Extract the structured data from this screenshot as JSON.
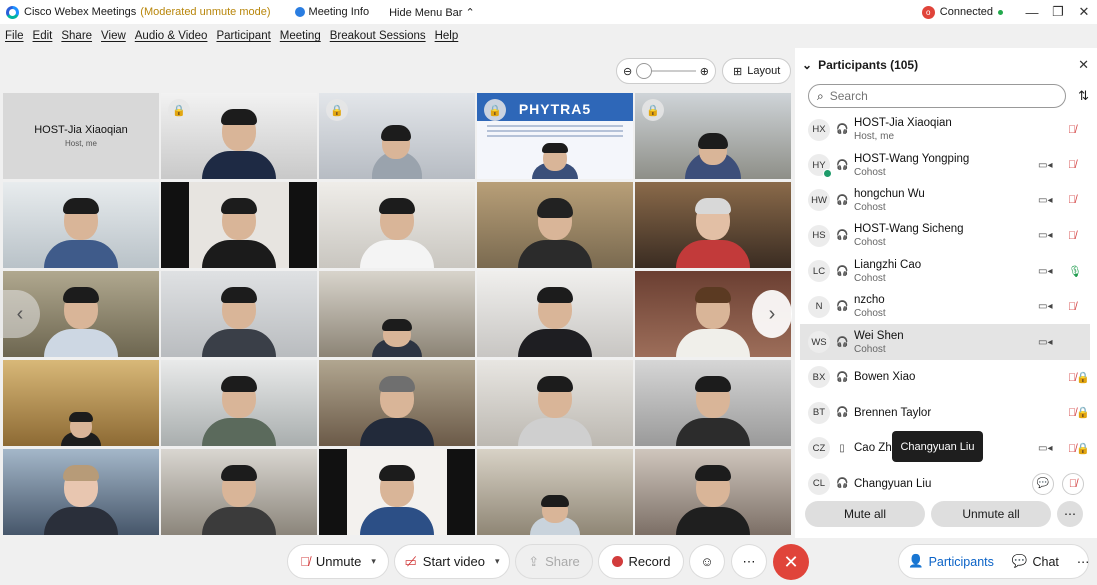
{
  "titlebar": {
    "app_title": "Cisco Webex Meetings",
    "mode": "(Moderated unmute mode)",
    "meeting_info": "Meeting Info",
    "hide_menu_bar": "Hide Menu Bar",
    "connection_status": "Connected",
    "status_color": "#22a94c"
  },
  "menu": [
    "File",
    "Edit",
    "Share",
    "View",
    "Audio & Video",
    "Participant",
    "Meeting",
    "Breakout Sessions",
    "Help"
  ],
  "stage": {
    "layout_label": "Layout",
    "host_tile": {
      "name": "HOST-Jia Xiaoqian",
      "role": "Host, me"
    },
    "slide_title": "PHYTRA5"
  },
  "participants_panel": {
    "title": "Participants (105)",
    "search_placeholder": "Search",
    "rows": [
      {
        "initials": "HX",
        "name": "HOST-Jia Xiaoqian",
        "role": "Host, me",
        "video": false,
        "mic": "muted"
      },
      {
        "initials": "HY",
        "name": "HOST-Wang Yongping",
        "role": "Cohost",
        "video": true,
        "mic": "muted"
      },
      {
        "initials": "HW",
        "name": "hongchun Wu",
        "role": "Cohost",
        "video": true,
        "mic": "muted"
      },
      {
        "initials": "HS",
        "name": "HOST-Wang Sicheng",
        "role": "Cohost",
        "video": true,
        "mic": "muted"
      },
      {
        "initials": "LC",
        "name": "Liangzhi Cao",
        "role": "Cohost",
        "video": true,
        "mic": "on"
      },
      {
        "initials": "N",
        "name": "nzcho",
        "role": "Cohost",
        "video": true,
        "mic": "muted"
      },
      {
        "initials": "WS",
        "name": "Wei Shen",
        "role": "Cohost",
        "video": true,
        "mic": "none"
      },
      {
        "initials": "BX",
        "name": "Bowen Xiao",
        "role": "",
        "video": false,
        "mic": "locked"
      },
      {
        "initials": "BT",
        "name": "Brennen Taylor",
        "role": "",
        "video": false,
        "mic": "locked"
      },
      {
        "initials": "CZ",
        "name": "Cao Zhi",
        "role": "",
        "video": true,
        "mic": "locked"
      },
      {
        "initials": "CL",
        "name": "Changyuan Liu",
        "role": "",
        "video": false,
        "mic": "muted"
      }
    ],
    "tooltip": "Changyuan Liu",
    "mute_all": "Mute all",
    "unmute_all": "Unmute all"
  },
  "toolbar": {
    "unmute": "Unmute",
    "start_video": "Start video",
    "share": "Share",
    "record": "Record",
    "participants": "Participants",
    "chat": "Chat"
  },
  "colors": {
    "accent": "#0b63c7",
    "end_red": "#e0443a",
    "muted_red": "#d23c3c"
  }
}
